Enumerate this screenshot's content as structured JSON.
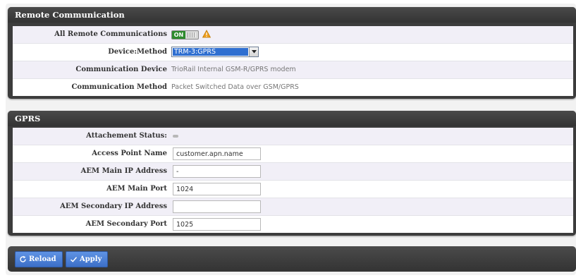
{
  "remote_panel": {
    "title": "Remote Communication",
    "rows": [
      {
        "label": "All Remote Communications",
        "toggle_text": "ON"
      },
      {
        "label": "Device:Method",
        "select_value": "TRM-3:GPRS"
      },
      {
        "label": "Communication Device",
        "value": "TrioRail Internal GSM-R/GPRS modem"
      },
      {
        "label": "Communication Method",
        "value": "Packet Switched Data over GSM/GPRS"
      }
    ]
  },
  "gprs_panel": {
    "title": "GPRS",
    "rows": [
      {
        "label": "Attachement Status:"
      },
      {
        "label": "Access Point Name",
        "value": "customer.apn.name"
      },
      {
        "label": "AEM Main IP Address",
        "value": "-"
      },
      {
        "label": "AEM Main Port",
        "value": "1024"
      },
      {
        "label": "AEM Secondary IP Address",
        "value": ""
      },
      {
        "label": "AEM Secondary Port",
        "value": "1025"
      }
    ]
  },
  "toolbar": {
    "reload_label": "Reload",
    "apply_label": "Apply"
  },
  "colors": {
    "panel_header": "#3c3c3c",
    "toggle_on": "#2e8b2e",
    "warning": "#f0a020",
    "select_highlight": "#2f6fd0",
    "button": "#4a7fd6"
  }
}
